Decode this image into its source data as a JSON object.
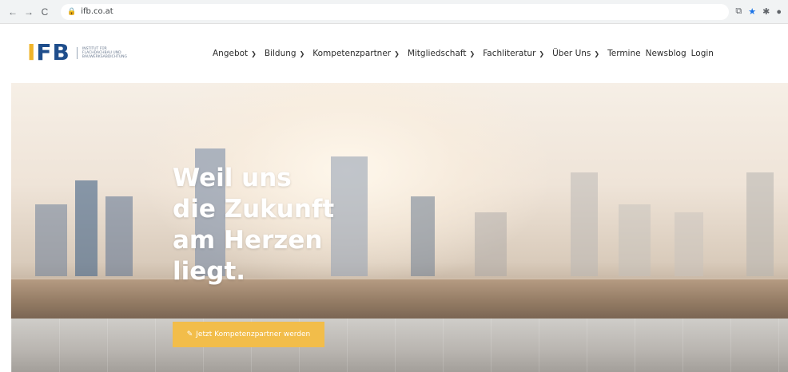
{
  "browser": {
    "back": "←",
    "forward": "→",
    "reload": "C",
    "url": "ifb.co.at",
    "lock_icon": "lock-icon",
    "extensions": [
      "share-icon",
      "star-icon",
      "puzzle-icon",
      "profile-icon"
    ]
  },
  "logo": {
    "mark_part1": "I",
    "mark_part2": "FB",
    "subtitle_line1": "INSTITUT FÜR",
    "subtitle_line2": "FLACHDACHBAU UND",
    "subtitle_line3": "BAUWERKSABDICHTUNG",
    "colors": {
      "accent": "#f0b429",
      "brand": "#1f4e8c"
    }
  },
  "nav": {
    "items": [
      {
        "label": "Angebot",
        "dropdown": true
      },
      {
        "label": "Bildung",
        "dropdown": true
      },
      {
        "label": "Kompetenzpartner",
        "dropdown": true
      },
      {
        "label": "Mitgliedschaft",
        "dropdown": true
      },
      {
        "label": "Fachliteratur",
        "dropdown": true
      },
      {
        "label": "Über Uns",
        "dropdown": true
      },
      {
        "label": "Termine",
        "dropdown": false
      },
      {
        "label": "Newsblog",
        "dropdown": false
      },
      {
        "label": "Login",
        "dropdown": false
      }
    ]
  },
  "hero": {
    "headline_lines": [
      "Weil uns",
      "die Zukunft",
      "am Herzen",
      "liegt."
    ],
    "cta_label": "Jetzt Kompetenzpartner werden",
    "cta_icon": "edit-icon",
    "cta_color": "#f2bd4a"
  }
}
